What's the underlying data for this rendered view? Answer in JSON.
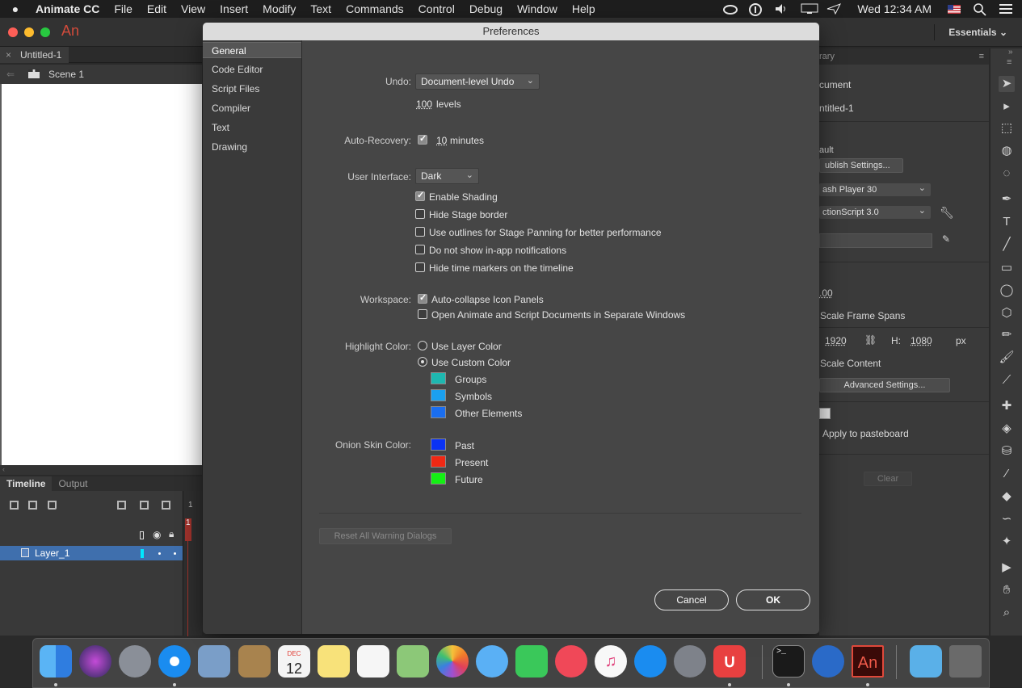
{
  "menubar": {
    "app": "Animate CC",
    "items": [
      "File",
      "Edit",
      "View",
      "Insert",
      "Modify",
      "Text",
      "Commands",
      "Control",
      "Debug",
      "Window",
      "Help"
    ],
    "clock": "Wed 12:34 AM"
  },
  "app": {
    "logo": "An",
    "workspace": "Essentials",
    "doc_tab": "Untitled-1",
    "scene": "Scene 1"
  },
  "timeline": {
    "tabs": [
      "Timeline",
      "Output"
    ],
    "layer": "Layer_1",
    "frame_number": "1"
  },
  "properties": {
    "tab_partial": "rary",
    "doc_type": "cument",
    "doc_name": "ntitled-1",
    "profile_label": "ault",
    "publish_button": "ublish Settings...",
    "target": "ash Player 30",
    "script": "ctionScript 3.0",
    "fps": ".00",
    "scale_frame_spans": "Scale Frame Spans",
    "width": "1920",
    "height_label": "H:",
    "height": "1080",
    "unit": "px",
    "scale_content": "Scale Content",
    "advanced_button": "Advanced Settings...",
    "apply_pasteboard": "Apply to pasteboard",
    "clear_button": "Clear"
  },
  "dialog": {
    "title": "Preferences",
    "categories": [
      "General",
      "Code Editor",
      "Script Files",
      "Compiler",
      "Text",
      "Drawing"
    ],
    "active_category": "General",
    "undo": {
      "label": "Undo:",
      "value": "Document-level Undo",
      "levels_value": "100",
      "levels_unit": "levels"
    },
    "auto_recovery": {
      "label": "Auto-Recovery:",
      "checked": true,
      "value": "10",
      "unit": "minutes"
    },
    "user_interface": {
      "label": "User Interface:",
      "value": "Dark",
      "options": [
        {
          "label": "Enable Shading",
          "checked": true
        },
        {
          "label": "Hide Stage border",
          "checked": false
        },
        {
          "label": "Use outlines for Stage Panning for better performance",
          "checked": false
        },
        {
          "label": "Do not show in-app notifications",
          "checked": false
        },
        {
          "label": "Hide time markers on the timeline",
          "checked": false
        }
      ]
    },
    "workspace": {
      "label": "Workspace:",
      "options": [
        {
          "label": "Auto-collapse Icon Panels",
          "checked": true
        },
        {
          "label": "Open Animate and Script Documents in Separate Windows",
          "checked": false
        }
      ]
    },
    "highlight_color": {
      "label": "Highlight Color:",
      "radios": [
        {
          "label": "Use Layer Color",
          "selected": false
        },
        {
          "label": "Use Custom Color",
          "selected": true
        }
      ],
      "swatches": [
        {
          "label": "Groups",
          "color": "#1eb8b0"
        },
        {
          "label": "Symbols",
          "color": "#1aa0f0"
        },
        {
          "label": "Other Elements",
          "color": "#1a6ef0"
        }
      ]
    },
    "onion_skin": {
      "label": "Onion Skin Color:",
      "swatches": [
        {
          "label": "Past",
          "color": "#0a32f5"
        },
        {
          "label": "Present",
          "color": "#f02814"
        },
        {
          "label": "Future",
          "color": "#14f014"
        }
      ]
    },
    "reset_button": "Reset All Warning Dialogs",
    "cancel_button": "Cancel",
    "ok_button": "OK"
  },
  "dock": {
    "icons": [
      "finder-icon",
      "siri-icon",
      "launchpad-icon",
      "safari-icon",
      "mail-icon",
      "contacts-icon",
      "calendar-icon",
      "notes-icon",
      "reminders-icon",
      "maps-icon",
      "photos-icon",
      "messages-icon",
      "facetime-icon",
      "news-icon",
      "itunes-icon",
      "app-store-icon",
      "system-preferences-icon",
      "magnet-icon",
      "terminal-icon",
      "1password-icon",
      "animate-icon",
      "folder-icon",
      "trash-icon"
    ],
    "calendar_month": "DEC",
    "calendar_day": "12",
    "animate_label": "An"
  }
}
